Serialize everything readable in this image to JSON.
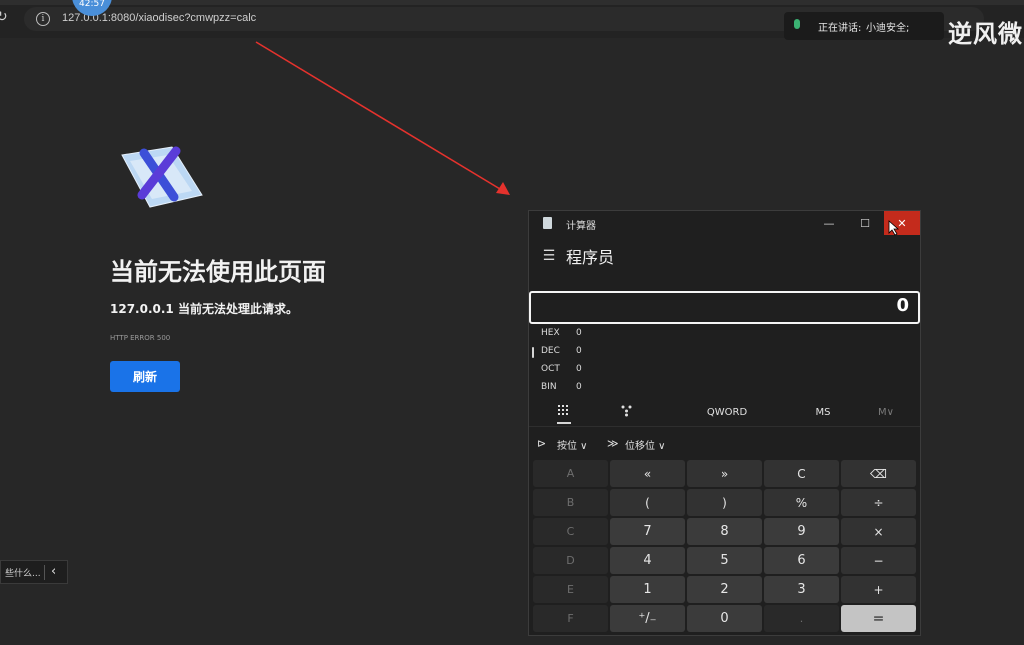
{
  "browser": {
    "url": "127.0.0.1:8080/xiaodisec?cmwpzz=calc",
    "timer": "42:57"
  },
  "speaking": {
    "label": "正在讲话:",
    "name": "小迪安全;"
  },
  "watermark": "逆风微",
  "error_page": {
    "title": "当前无法使用此页面",
    "subtitle": "127.0.0.1 当前无法处理此请求。",
    "code": "HTTP ERROR 500",
    "reload_label": "刷新"
  },
  "side_popup": {
    "text": "些什么..."
  },
  "calculator": {
    "window_title": "计算器",
    "mode": "程序员",
    "display": "0",
    "radix": [
      {
        "name": "HEX",
        "value": "0"
      },
      {
        "name": "DEC",
        "value": "0"
      },
      {
        "name": "OCT",
        "value": "0"
      },
      {
        "name": "BIN",
        "value": "0"
      }
    ],
    "selected_radix": "DEC",
    "toolbar": {
      "word_size": "QWORD",
      "ms": "MS",
      "mv": "M∨"
    },
    "dropdowns": {
      "bitwise": "按位 ∨",
      "bitshift": "位移位 ∨"
    },
    "keys": [
      [
        "A",
        "«",
        "»",
        "C",
        "⌫"
      ],
      [
        "B",
        "(",
        ")",
        "%",
        "÷"
      ],
      [
        "C",
        "7",
        "8",
        "9",
        "×"
      ],
      [
        "D",
        "4",
        "5",
        "6",
        "−"
      ],
      [
        "E",
        "1",
        "2",
        "3",
        "+"
      ],
      [
        "F",
        "⁺/₋",
        "0",
        ".",
        "="
      ]
    ]
  },
  "icons": [
    "refresh-icon",
    "info-icon",
    "microphone-icon",
    "error-page-icon",
    "calculator-app-icon",
    "minimize-icon",
    "maximize-icon",
    "close-icon",
    "hamburger-icon",
    "keypad-icon",
    "bit-toggle-icon",
    "bitwise-icon",
    "bitshift-icon",
    "backspace-icon",
    "chevron-left-icon"
  ],
  "colors": {
    "accent_blue": "#1a73e8",
    "close_red": "#c42b1c",
    "arrow_red": "#e5322d",
    "mic_green": "#3bb273"
  }
}
